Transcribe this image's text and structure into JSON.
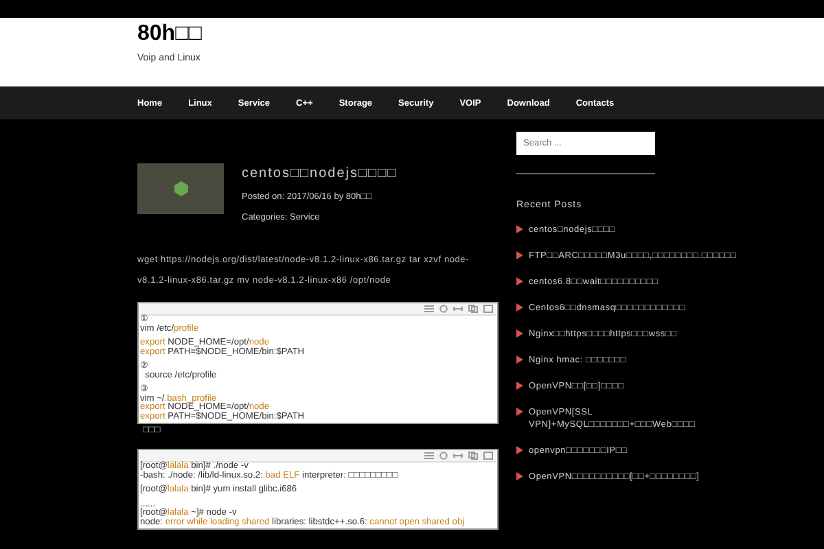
{
  "site": {
    "title": "80h□□",
    "tagline": "Voip and Linux"
  },
  "nav": [
    "Home",
    "Linux",
    "Service",
    "C++",
    "Storage",
    "Security",
    "VOIP",
    "Download",
    "Contacts"
  ],
  "post": {
    "title": "centos□□nodejs□□□□",
    "posted": "Posted on: 2017/06/16 by 80h□□",
    "categories": "Categories: Service",
    "paragraph": "wget https://nodejs.org/dist/latest/node-v8.1.2-linux-x86.tar.gz tar xzvf node-v8.1.2-linux-x86.tar.gz mv node-v8.1.2-linux-x86 /opt/node",
    "code_blocks": [
      {
        "groups": [
          [
            [
              {
                "t": "①",
                "hl": false
              }
            ],
            [
              {
                "t": "vim /etc/",
                "hl": false
              },
              {
                "t": "profile",
                "hl": true
              }
            ]
          ],
          [
            [
              {
                "t": "export",
                "hl": true
              },
              {
                "t": " NODE_HOME=/opt/",
                "hl": false
              },
              {
                "t": "node",
                "hl": true
              }
            ],
            [
              {
                "t": "export",
                "hl": true
              },
              {
                "t": " PATH=$NODE_HOME/bin:$PATH",
                "hl": false
              }
            ]
          ],
          [
            [
              {
                "t": "②",
                "hl": false
              }
            ],
            [
              {
                "t": "  source /etc/profile",
                "hl": false
              }
            ]
          ],
          [
            [
              {
                "t": "③",
                "hl": false
              }
            ],
            [
              {
                "t": "vim ~/",
                "hl": false
              },
              {
                "t": ".bash_profile",
                "hl": true
              }
            ],
            [
              {
                "t": "export",
                "hl": true
              },
              {
                "t": " NODE_HOME=/opt/",
                "hl": false
              },
              {
                "t": "node",
                "hl": true
              }
            ],
            [
              {
                "t": "export",
                "hl": true
              },
              {
                "t": " PATH=$NODE_HOME/bin:$PATH",
                "hl": false
              }
            ]
          ]
        ],
        "after": "□□□"
      },
      {
        "groups": [
          [
            [
              {
                "t": "[root@",
                "hl": false
              },
              {
                "t": "lalala",
                "hl": true
              },
              {
                "t": " bin]# ./node -v",
                "hl": false
              }
            ],
            [
              {
                "t": "-bash: ./node: /lib/ld-linux.so.2: ",
                "hl": false
              },
              {
                "t": "bad ELF",
                "hl": true
              },
              {
                "t": " interpreter: □□□□□□□□□",
                "hl": false
              }
            ]
          ],
          [
            [
              {
                "t": "[root@",
                "hl": false
              },
              {
                "t": "lalala",
                "hl": true
              },
              {
                "t": " bin]# yum install glibc.i686",
                "hl": false
              }
            ]
          ],
          [
            [
              {
                "t": "......",
                "hl": false
              }
            ],
            [
              {
                "t": "[root@",
                "hl": false
              },
              {
                "t": "lalala",
                "hl": true
              },
              {
                "t": " ~]# node -v",
                "hl": false
              }
            ],
            [
              {
                "t": "node: ",
                "hl": false
              },
              {
                "t": "error while loading shared",
                "hl": true
              },
              {
                "t": " libraries: libstdc++.so.6: ",
                "hl": false
              },
              {
                "t": "cannot open shared obj",
                "hl": true
              }
            ]
          ]
        ]
      }
    ]
  },
  "sidebar": {
    "search": {
      "placeholder": "Search ..."
    },
    "heading": "Recent Posts",
    "posts": [
      "centos□nodejs□□□□",
      "FTP□□ARC□□□□□M3u□□□□,□□□□□□□□.□□□□□□",
      "centos6.8□□wait□□□□□□□□□□",
      "Centos6□□dnsmasq□□□□□□□□□□□□",
      "Nginx□□https□□□□https□□□wss□□",
      "Nginx hmac: □□□□□□□",
      "OpenVPN□□[□□]□□□□",
      "OpenVPN[SSL VPN]+MySQL□□□□□□□+□□□Web□□□□",
      "openvpn□□□□□□□IP□□",
      "OpenVPN□□□□□□□□□□[□□+□□□□□□□□]"
    ]
  }
}
